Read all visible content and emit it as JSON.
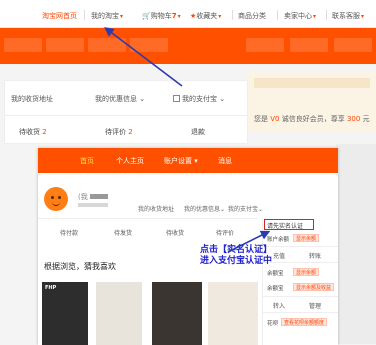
{
  "top_nav": {
    "items": [
      {
        "label": "淘宝网首页",
        "active": true
      },
      {
        "label": "我的淘宝",
        "dropdown": true
      },
      {
        "label": "购物车",
        "count": "7",
        "dropdown": true
      },
      {
        "label": "收藏夹",
        "dropdown": true
      },
      {
        "label": "商品分类"
      },
      {
        "label": "卖家中心",
        "dropdown": true
      },
      {
        "label": "联系客服",
        "dropdown": true
      }
    ]
  },
  "background_account": {
    "headers": [
      "我的收货地址",
      "我的优惠信息",
      "我的支付宝"
    ],
    "status": [
      {
        "label": "待收货",
        "count": "2"
      },
      {
        "label": "待评价",
        "count": "2"
      },
      {
        "label": "退款",
        "count": ""
      }
    ]
  },
  "banner": {
    "prefix": "您是",
    "level": "V0",
    "text": "诚信良好会员，尊享",
    "num": "300",
    "suffix": "元"
  },
  "front_window": {
    "nav": [
      "首页",
      "个人主页",
      "账户设置",
      "消息"
    ],
    "nav_active": 0,
    "account_settings_dropdown": true,
    "user_name_prefix": "(我",
    "headers": [
      "我的收货地址",
      "我的优惠信息",
      "我的支付宝"
    ],
    "status": [
      "待付款",
      "待发货",
      "待收货",
      "待评价"
    ],
    "section_title": "根据浏览，猜我喜欢",
    "products": [
      {
        "label": "FHP",
        "color": "#2d2d2d"
      },
      {
        "label": "",
        "color": "#e8e4dc"
      },
      {
        "label": "",
        "color": "#3a3530"
      },
      {
        "label": "",
        "color": "#efe9e0"
      }
    ],
    "right_panel": {
      "verify_label": "请先实名认证",
      "balance_label": "账户余额",
      "balance_btn": "显示余额",
      "cells_1": [
        "充值",
        "转账"
      ],
      "yuebao_label": "余额宝",
      "yuebao_btn": "显示余额",
      "yuebao_btn2": "显示余额及收益",
      "cells_2": [
        "转入",
        "管理"
      ],
      "huabei_label": "花呗",
      "huabei_btn": "查看花呗余额额度"
    }
  },
  "annotation": {
    "line1": "点击【实名认证】",
    "line2": "进入支付宝认证中"
  },
  "colors": {
    "taobao_orange": "#ff5000",
    "accent_red": "#e02020",
    "annotation_blue": "#2222cc",
    "highlight_yellow": "#ffe14d"
  }
}
